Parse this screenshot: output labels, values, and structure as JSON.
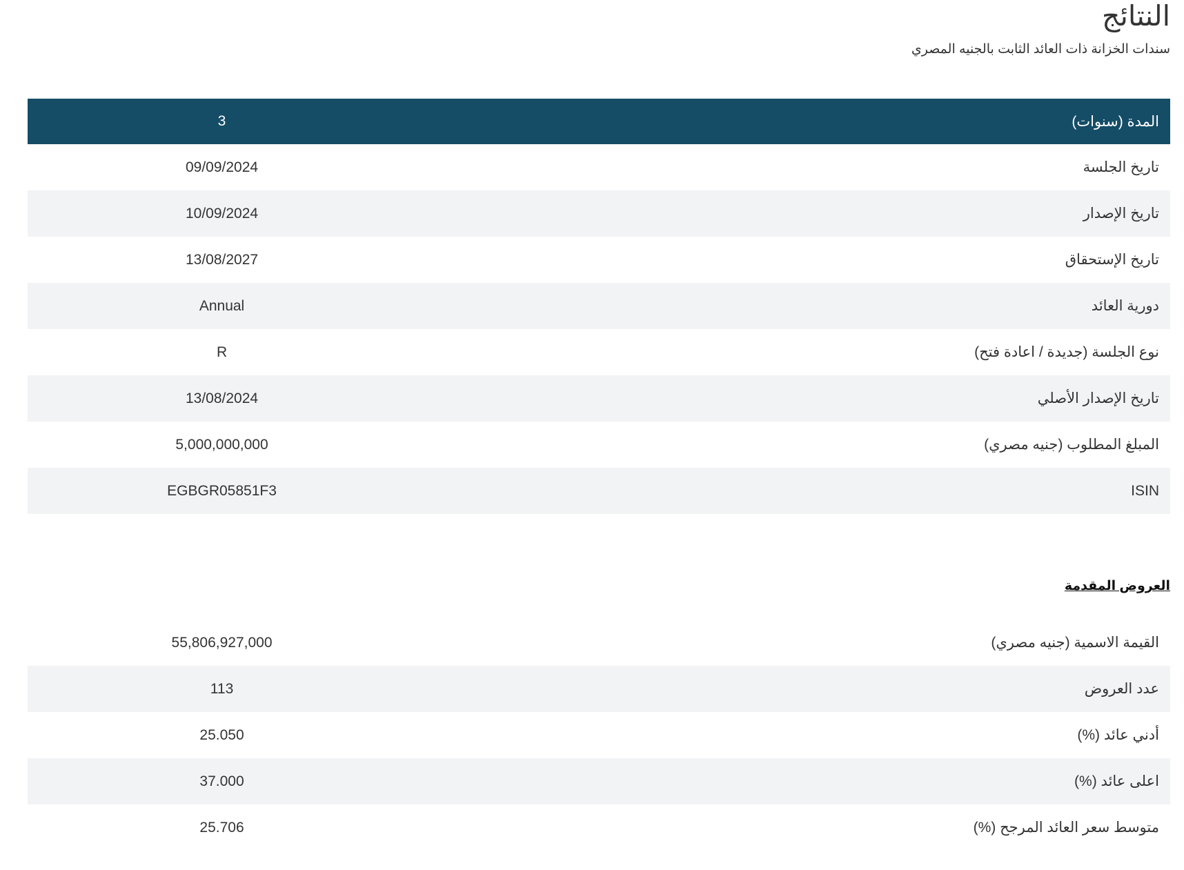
{
  "page": {
    "title": "النتائج",
    "subtitle": "سندات الخزانة ذات العائد الثابت بالجنيه المصري"
  },
  "results": {
    "header": {
      "label": "المدة (سنوات)",
      "value": "3"
    },
    "rows": [
      {
        "label": "تاريخ الجلسة",
        "value": "09/09/2024"
      },
      {
        "label": "تاريخ الإصدار",
        "value": "10/09/2024"
      },
      {
        "label": "تاريخ الإستحقاق",
        "value": "13/08/2027"
      },
      {
        "label": "دورية العائد",
        "value": "Annual"
      },
      {
        "label": "نوع الجلسة (جديدة / اعادة فتح)",
        "value": "R"
      },
      {
        "label": "تاريخ الإصدار الأصلي",
        "value": "13/08/2024"
      },
      {
        "label": "المبلغ المطلوب (جنيه مصري)",
        "value": "5,000,000,000"
      },
      {
        "label": "ISIN",
        "value": "EGBGR05851F3"
      }
    ]
  },
  "offers": {
    "heading": "العروض المقدمة",
    "rows": [
      {
        "label": "القيمة الاسمية (جنيه مصري)",
        "value": "55,806,927,000"
      },
      {
        "label": "عدد العروض",
        "value": "113"
      },
      {
        "label": "أدني عائد (%)",
        "value": "25.050"
      },
      {
        "label": "اعلى عائد (%)",
        "value": "37.000"
      },
      {
        "label": "متوسط سعر العائد المرجح (%)",
        "value": "25.706"
      }
    ]
  }
}
